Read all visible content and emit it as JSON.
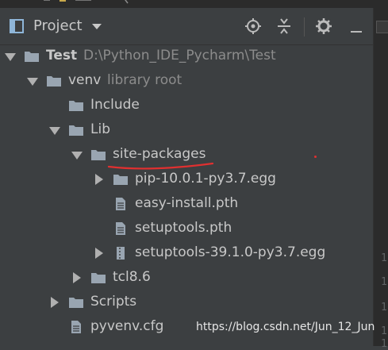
{
  "panel": {
    "title": "Project",
    "icons": [
      "project-window-icon",
      "locate-icon",
      "collapse-all-icon",
      "settings-icon"
    ]
  },
  "tree": [
    {
      "label": "Test",
      "sub": "D:\\Python_IDE_Pycharm\\Test",
      "icon": "folder-icon",
      "state": "expanded",
      "bold": true
    },
    {
      "label": "venv",
      "sub": "library root",
      "icon": "folder-icon",
      "state": "expanded"
    },
    {
      "label": "Include",
      "icon": "folder-icon",
      "state": "leaf"
    },
    {
      "label": "Lib",
      "icon": "folder-icon",
      "state": "expanded"
    },
    {
      "label": "site-packages",
      "icon": "folder-icon",
      "state": "expanded"
    },
    {
      "label": "pip-10.0.1-py3.7.egg",
      "icon": "folder-icon",
      "state": "collapsed"
    },
    {
      "label": "easy-install.pth",
      "icon": "file-icon",
      "state": "leaf"
    },
    {
      "label": "setuptools.pth",
      "icon": "file-icon",
      "state": "leaf"
    },
    {
      "label": "setuptools-39.1.0-py3.7.egg",
      "icon": "archive-icon",
      "state": "collapsed"
    },
    {
      "label": "tcl8.6",
      "icon": "folder-icon",
      "state": "collapsed"
    },
    {
      "label": "Scripts",
      "icon": "folder-icon",
      "state": "collapsed"
    },
    {
      "label": "pyvenv.cfg",
      "icon": "file-icon",
      "state": "leaf"
    }
  ],
  "gutter_lines": [
    "1",
    "1",
    "1",
    "1",
    "1"
  ],
  "watermark": "https://blog.csdn.net/Jun_12_Jun",
  "colors": {
    "background": "#3c3f41",
    "text": "#c8c8c8",
    "annotation": "#e03030"
  }
}
